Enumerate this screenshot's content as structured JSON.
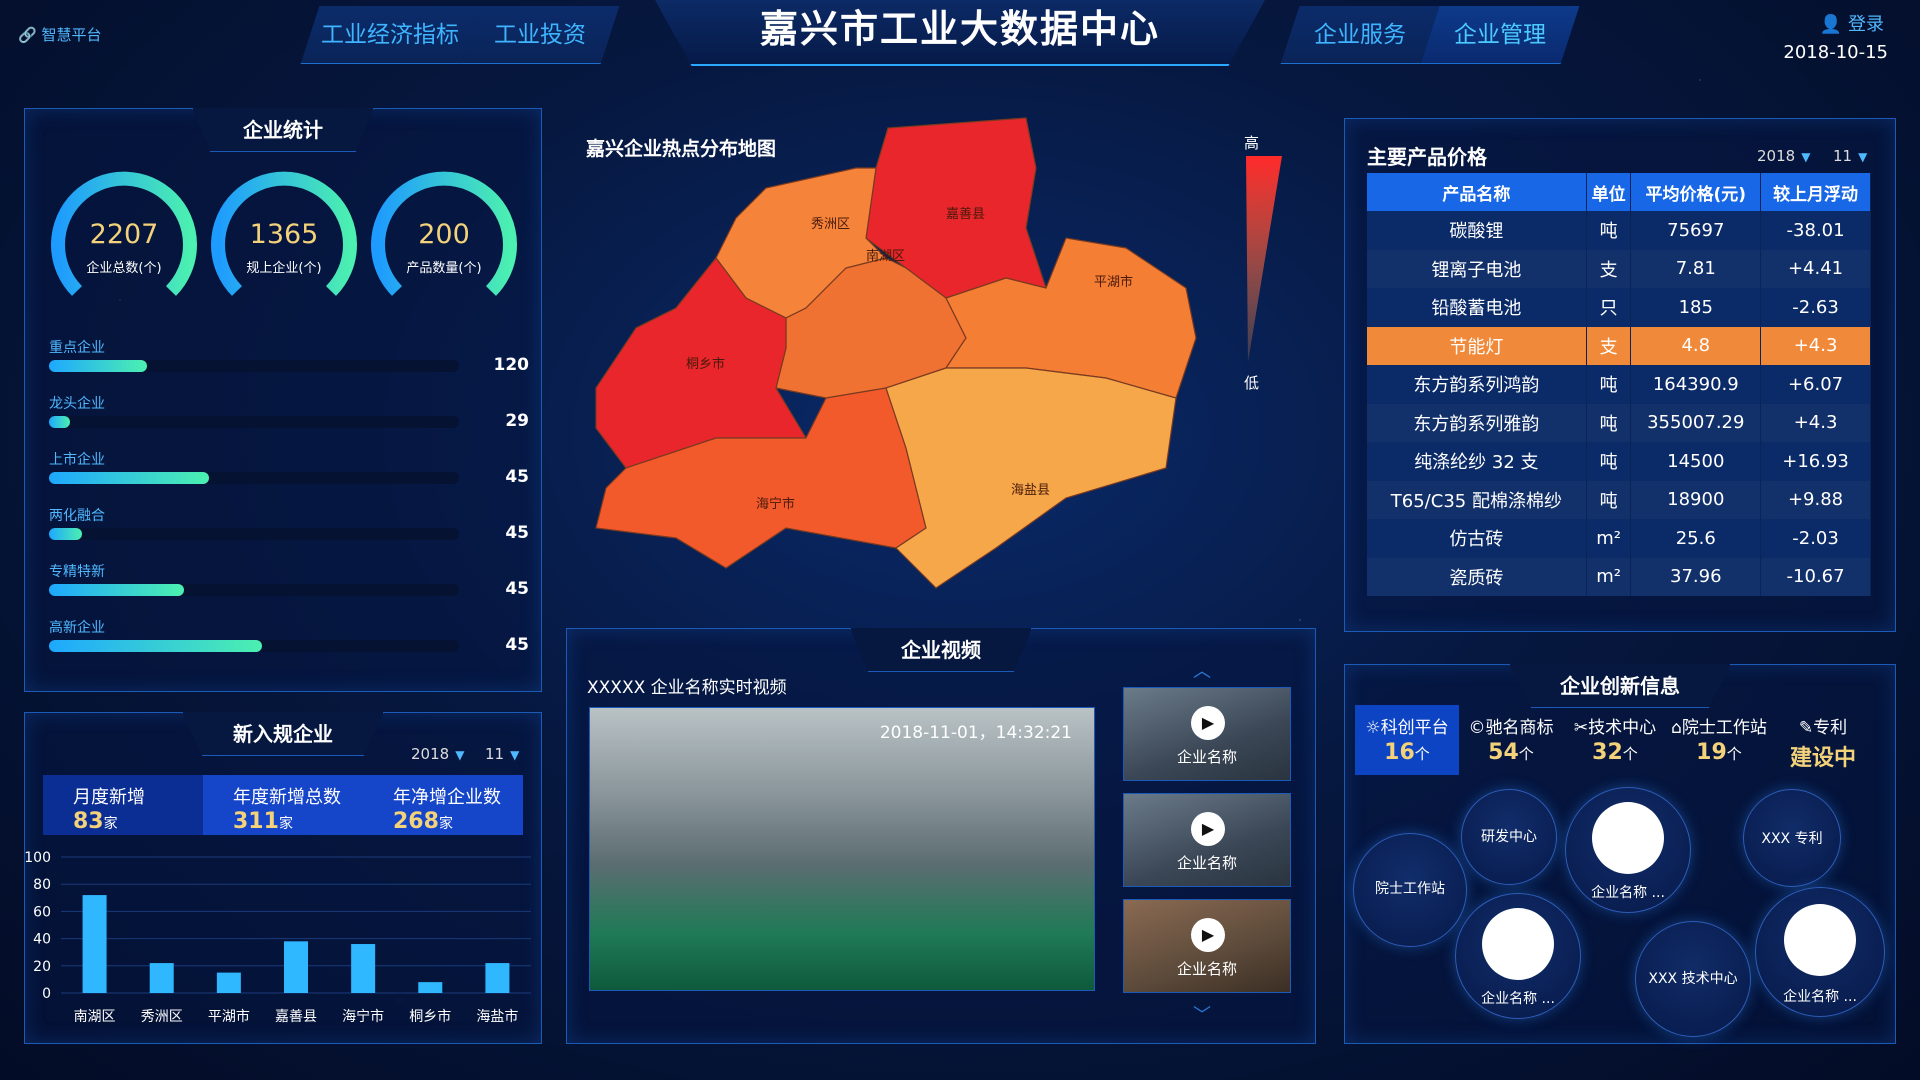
{
  "header": {
    "brand": "智慧平台",
    "title": "嘉兴市工业大数据中心",
    "nav_left": [
      "工业经济指标",
      "工业投资"
    ],
    "nav_right": [
      "企业服务",
      "企业管理"
    ],
    "active_tab": "企业管理",
    "login": "登录",
    "date": "2018-10-15"
  },
  "enterprise_stats": {
    "title": "企业统计",
    "gauges": [
      {
        "value": "2207",
        "label": "企业总数(个)"
      },
      {
        "value": "1365",
        "label": "规上企业(个)"
      },
      {
        "value": "200",
        "label": "产品数量(个)"
      }
    ],
    "bars": [
      {
        "name": "重点企业",
        "value": "120",
        "fill": 0.24
      },
      {
        "name": "龙头企业",
        "value": "29",
        "fill": 0.05
      },
      {
        "name": "上市企业",
        "value": "45",
        "fill": 0.39
      },
      {
        "name": "两化融合",
        "value": "45",
        "fill": 0.08
      },
      {
        "name": "专精特新",
        "value": "45",
        "fill": 0.33
      },
      {
        "name": "高新企业",
        "value": "45",
        "fill": 0.52
      }
    ]
  },
  "new_enterprises": {
    "title": "新入规企业",
    "year": "2018",
    "month": "11",
    "stats": [
      {
        "label": "月度新增",
        "value": "83",
        "unit": "家"
      },
      {
        "label": "年度新增总数",
        "value": "311",
        "unit": "家"
      },
      {
        "label": "年净增企业数",
        "value": "268",
        "unit": "家"
      }
    ]
  },
  "chart_data": {
    "type": "bar",
    "categories": [
      "南湖区",
      "秀洲区",
      "平湖市",
      "嘉善县",
      "海宁市",
      "桐乡市",
      "海盐市"
    ],
    "values": [
      72,
      22,
      15,
      38,
      36,
      8,
      22
    ],
    "ylim": [
      0,
      100
    ],
    "yticks": [
      "0",
      "20",
      "40",
      "60",
      "80",
      "100"
    ],
    "color": "#2fb8ff"
  },
  "map": {
    "title": "嘉兴企业热点分布地图",
    "legend_high": "高",
    "legend_low": "低",
    "regions": [
      {
        "name": "嘉善县",
        "color": "#e8262b"
      },
      {
        "name": "秀洲区",
        "color": "#f5843a"
      },
      {
        "name": "南湖区",
        "color": "#f07232"
      },
      {
        "name": "平湖市",
        "color": "#f47e34"
      },
      {
        "name": "桐乡市",
        "color": "#e8262b"
      },
      {
        "name": "海宁市",
        "color": "#f25a2c"
      },
      {
        "name": "海盐县",
        "color": "#f6a74a"
      }
    ]
  },
  "video": {
    "title": "企业视频",
    "subtitle": "XXXXX 企业名称实时视频",
    "timestamp": "2018-11-01，14:32:21",
    "thumbs": [
      "企业名称",
      "企业名称",
      "企业名称"
    ]
  },
  "prices": {
    "title": "主要产品价格",
    "year": "2018",
    "month": "11",
    "columns": [
      "产品名称",
      "单位",
      "平均价格(元)",
      "较上月浮动"
    ],
    "rows": [
      [
        "碳酸锂",
        "吨",
        "75697",
        "-38.01"
      ],
      [
        "锂离子电池",
        "支",
        "7.81",
        "+4.41"
      ],
      [
        "铅酸蓄电池",
        "只",
        "185",
        "-2.63"
      ],
      [
        "节能灯",
        "支",
        "4.8",
        "+4.3"
      ],
      [
        "东方韵系列鸿韵",
        "吨",
        "164390.9",
        "+6.07"
      ],
      [
        "东方韵系列雅韵",
        "吨",
        "355007.29",
        "+4.3"
      ],
      [
        "纯涤纶纱 32 支",
        "吨",
        "14500",
        "+16.93"
      ],
      [
        "T65/C35 配棉涤棉纱",
        "吨",
        "18900",
        "+9.88"
      ],
      [
        "仿古砖",
        "m²",
        "25.6",
        "-2.03"
      ],
      [
        "瓷质砖",
        "m²",
        "37.96",
        "-10.67"
      ]
    ],
    "highlight_row": 3
  },
  "innovation": {
    "title": "企业创新信息",
    "tabs": [
      {
        "icon": "bulb-icon",
        "label": "科创平台",
        "value": "16",
        "unit": "个"
      },
      {
        "icon": "copyright-icon",
        "label": "驰名商标",
        "value": "54",
        "unit": "个"
      },
      {
        "icon": "tools-icon",
        "label": "技术中心",
        "value": "32",
        "unit": "个"
      },
      {
        "icon": "graduation-icon",
        "label": "院士工作站",
        "value": "19",
        "unit": "个"
      },
      {
        "icon": "patent-icon",
        "label": "专利",
        "value": "建设中",
        "unit": ""
      }
    ],
    "bubbles": [
      "研发中心",
      "企业名称 ...",
      "XXX 专利",
      "院士工作站",
      "企业名称 ...",
      "XXX 技术中心",
      "企业名称 ..."
    ]
  }
}
